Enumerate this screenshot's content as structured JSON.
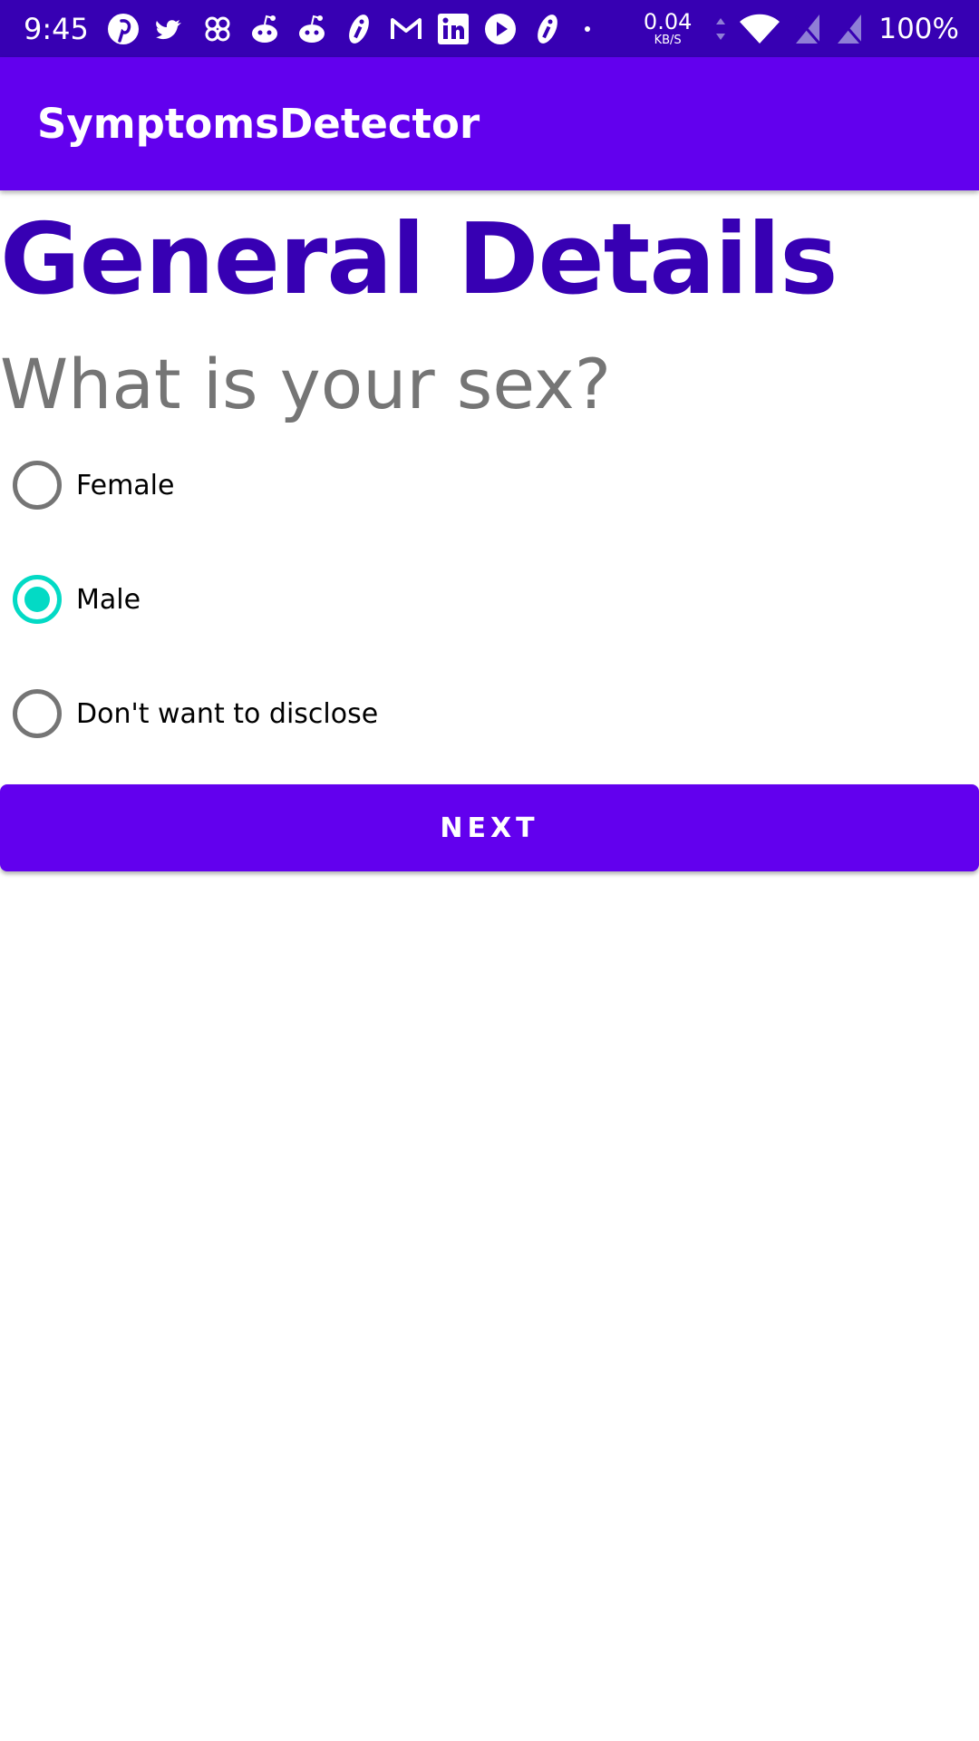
{
  "status_bar": {
    "time": "9:45",
    "notification_icons": [
      "pinterest-icon",
      "twitter-icon",
      "pinwheel-icon",
      "reddit-icon",
      "reddit-icon",
      "app-icon",
      "gmail-icon",
      "linkedin-icon",
      "youtube-icon",
      "app-icon",
      "more-dot-icon"
    ],
    "net_speed_value": "0.04",
    "net_speed_unit": "KB/S",
    "battery": "100%"
  },
  "app_bar": {
    "title": "SymptomsDetector"
  },
  "page": {
    "heading": "General Details",
    "question": "What is your sex?",
    "options": [
      {
        "label": "Female",
        "selected": false
      },
      {
        "label": "Male",
        "selected": true
      },
      {
        "label": "Don't want to disclose",
        "selected": false
      }
    ],
    "next_label": "NEXT"
  },
  "colors": {
    "primary": "#6200EE",
    "primary_dark": "#3700B3",
    "accent": "#03DAC5",
    "question_text": "#757575"
  }
}
